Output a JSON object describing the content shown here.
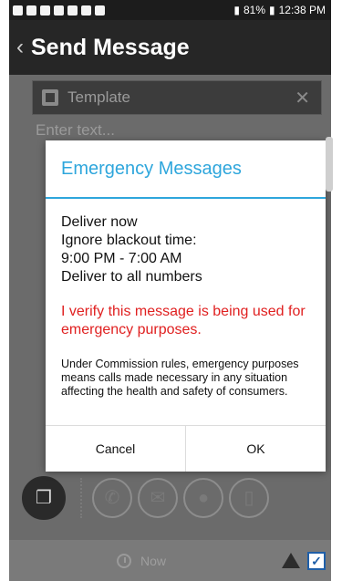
{
  "status_bar": {
    "battery": "81%",
    "time": "12:38 PM"
  },
  "app_bar": {
    "title": "Send Message",
    "back_icon": "chevron-left"
  },
  "compose": {
    "template_label": "Template",
    "text_placeholder": "Enter text..."
  },
  "dialog": {
    "title": "Emergency Messages",
    "lines": [
      "Deliver now",
      "Ignore blackout time:",
      "9:00 PM - 7:00 AM",
      "Deliver to all numbers"
    ],
    "verify_text": "I verify this message is being used for emergency purposes.",
    "rules_text": "Under Commission rules, emergency purposes means calls made necessary in any situation affecting the health and safety of consumers.",
    "cancel_label": "Cancel",
    "ok_label": "OK"
  },
  "footer": {
    "schedule_label": "Now"
  },
  "colors": {
    "accent": "#2ea6dc",
    "warning_text": "#e02020",
    "appbar_bg": "#262626"
  }
}
